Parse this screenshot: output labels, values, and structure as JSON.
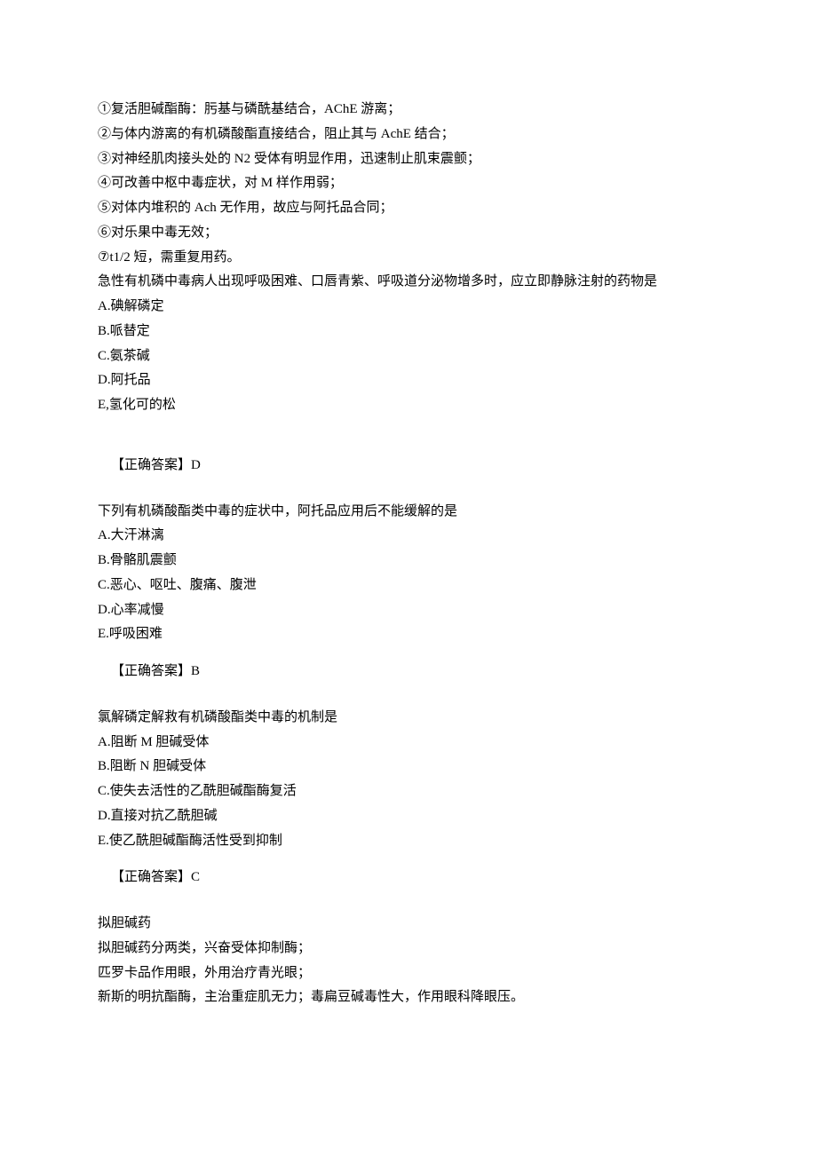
{
  "intro": {
    "lines": [
      "①复活胆碱酯酶：肟基与磷酰基结合，AChE 游离；",
      "②与体内游离的有机磷酸酯直接结合，阻止其与 AchE 结合；",
      "③对神经肌肉接头处的 N2 受体有明显作用，迅速制止肌束震颤；",
      "④可改善中枢中毒症状，对 M 样作用弱；",
      "⑤对体内堆积的 Ach 无作用，故应与阿托品合同；",
      "⑥对乐果中毒无效；",
      "⑦t1/2 短，需重复用药。"
    ]
  },
  "q1": {
    "stem": "急性有机磷中毒病人出现呼吸困难、口唇青紫、呼吸道分泌物增多时，应立即静脉注射的药物是",
    "options": [
      "A.碘解磷定",
      "B.哌替定",
      "C.氨茶碱",
      "D.阿托品",
      "E,氢化可的松"
    ],
    "answer": "【正确答案】D"
  },
  "q2": {
    "stem": "下列有机磷酸酯类中毒的症状中，阿托品应用后不能缓解的是",
    "options": [
      "A.大汗淋漓",
      "B.骨骼肌震颤",
      "C.恶心、呕吐、腹痛、腹泄",
      "D.心率减慢",
      "E.呼吸困难"
    ],
    "answer": "【正确答案】B"
  },
  "q3": {
    "stem": "氯解磷定解救有机磷酸酯类中毒的机制是",
    "options": [
      "A.阻断 M 胆碱受体",
      "B.阻断 N 胆碱受体",
      "C.使失去活性的乙酰胆碱酯酶复活",
      "D.直接对抗乙酰胆碱",
      "E.使乙酰胆碱酯酶活性受到抑制"
    ],
    "answer": "【正确答案】C"
  },
  "notes": {
    "title": "拟胆碱药",
    "lines": [
      "拟胆碱药分两类，兴奋受体抑制酶；",
      "匹罗卡品作用眼，外用治疗青光眼；",
      "新斯的明抗酯酶，主治重症肌无力；毒扁豆碱毒性大，作用眼科降眼压。"
    ]
  }
}
